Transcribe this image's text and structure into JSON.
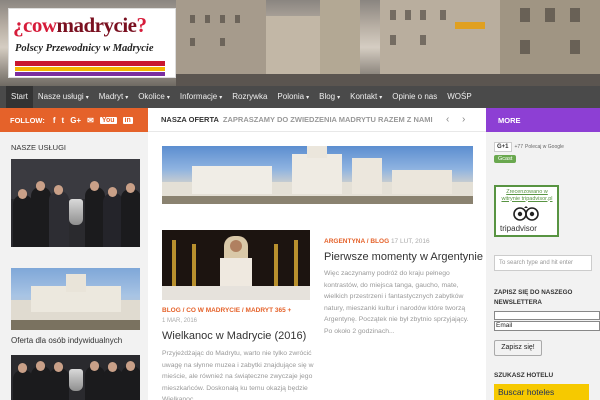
{
  "header": {
    "logo_question_open": "¿",
    "logo_word_cow": "cow",
    "logo_word_madrycie": "madrycie",
    "logo_question_close": "?",
    "logo_subtitle": "Polscy Przewodnicy w Madrycie"
  },
  "nav": {
    "items": [
      {
        "label": "Start",
        "dropdown": false
      },
      {
        "label": "Nasze usługi",
        "dropdown": true
      },
      {
        "label": "Madryt",
        "dropdown": true
      },
      {
        "label": "Okolice",
        "dropdown": true
      },
      {
        "label": "Informacje",
        "dropdown": true
      },
      {
        "label": "Rozrywka",
        "dropdown": false
      },
      {
        "label": "Polonia",
        "dropdown": true
      },
      {
        "label": "Blog",
        "dropdown": true
      },
      {
        "label": "Kontakt",
        "dropdown": true
      },
      {
        "label": "Opinie o nas",
        "dropdown": false
      },
      {
        "label": "WOŚP",
        "dropdown": false
      }
    ],
    "caret": "▾"
  },
  "left": {
    "follow_label": "FOLLOW:",
    "social": {
      "facebook": "f",
      "twitter": "t",
      "gplus": "G+",
      "email": "✉",
      "youtube": "You",
      "linkedin": "in"
    },
    "services_title": "NASZE USŁUGI",
    "offer_text": "Oferta dla osób indywidualnych"
  },
  "center": {
    "offer_label": "NASZA OFERTA",
    "offer_tagline": "ZAPRASZAMY DO ZWIEDZENIA MADRYTU RAZEM Z NAMI",
    "prev_arrow": "‹",
    "next_arrow": "›",
    "post_left": {
      "meta": "BLOG / CO W MADRYCIE / MADRYT 365 +",
      "date": "1 MAR, 2016",
      "title": "Wielkanoc w Madrycie (2016)",
      "excerpt": "Przyjeżdżając do Madrytu, warto nie tylko zwrócić uwagę na słynne muzea i zabytki znajdujące się w mieście, ale również na świąteczne zwyczaje jego mieszkańców. Doskonałą ku temu okazją będzie Wielkanoc"
    },
    "post_right": {
      "meta": "ARGENTYNA / BLOG",
      "date": "17 LUT, 2016",
      "title": "Pierwsze momenty w Argentynie",
      "excerpt": "Więc zaczynamy podróż do kraju pełnego kontrastów, do miejsca tanga, gaucho, mate, wielkich przestrzeni i fantastycznych zabytków natury, mieszanki kultur i narodów które tworzą Argentynę. Początek nie był zbytnio sprzyjający. Po około 2 godzinach..."
    }
  },
  "right": {
    "more_label": "MORE",
    "gplus_btn": "G+1",
    "gplus_count": "+77",
    "gplus_text": "Polecaj w Google",
    "gcast_btn": "Gcast",
    "trip_recommended": "Zrecenzowano w witrynie tripadvisor.pl",
    "trip_brand": "tripadvisor",
    "search_placeholder": "To search type and hit enter",
    "newsletter_title": "ZAPISZ SIĘ DO NASZEGO NEWSLETTERA",
    "email_value": "Email",
    "submit_label": "Zapisz się!",
    "hotel_title": "SZUKASZ HOTELU",
    "hotel_button": "Buscar hoteles"
  },
  "colors": {
    "follow_bar": "#e5622a",
    "more_bar": "#8d3fd4",
    "nav_bg": "#4a4a4a",
    "logo_red": "#c9172f",
    "logo_yellow": "#f5b400",
    "logo_purple": "#7a2fa0",
    "hotel_button": "#f6c900"
  }
}
